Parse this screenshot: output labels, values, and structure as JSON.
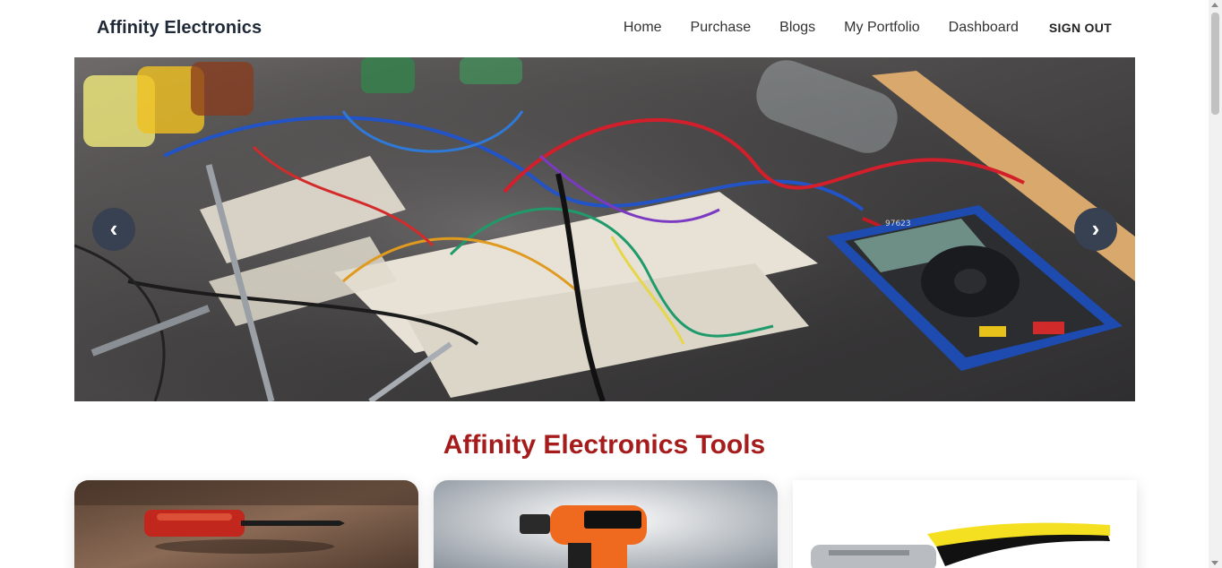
{
  "navbar": {
    "brand": "Affinity Electronics",
    "links": [
      "Home",
      "Purchase",
      "Blogs",
      "My Portfolio",
      "Dashboard"
    ],
    "signout": "SIGN OUT"
  },
  "carousel": {
    "prev_label": "‹",
    "next_label": "›",
    "multimeter_display": "97623"
  },
  "section": {
    "title": "Affinity Electronics Tools"
  },
  "products": [
    {
      "icon": "screwdriver-icon"
    },
    {
      "icon": "power-drill-icon"
    },
    {
      "icon": "pliers-icon"
    }
  ]
}
